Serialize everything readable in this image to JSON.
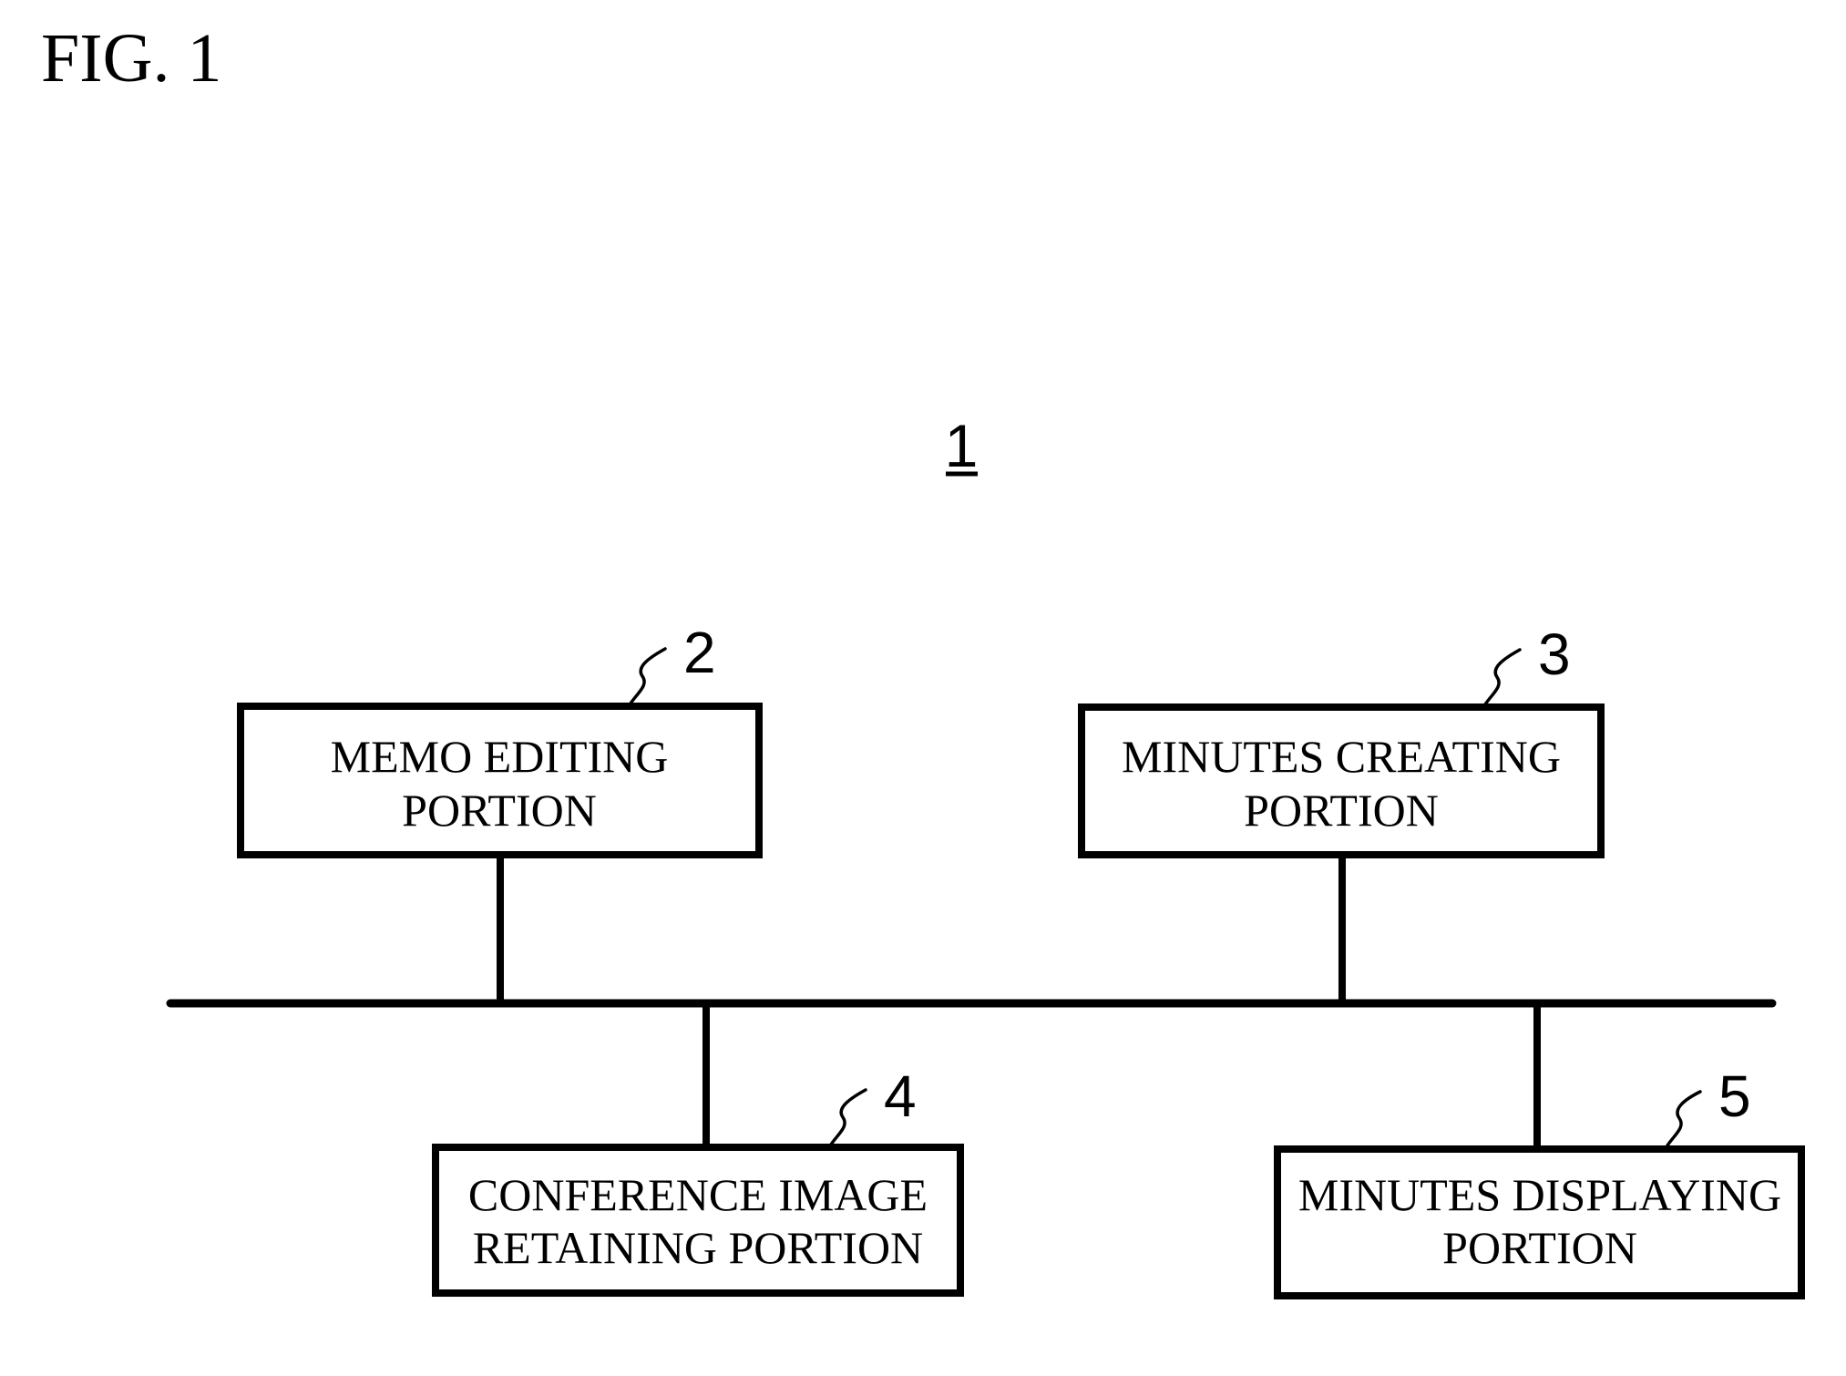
{
  "figure": {
    "title": "FIG. 1",
    "system_ref": "1"
  },
  "components": [
    {
      "ref": "2",
      "lines": [
        "MEMO EDITING",
        "PORTION"
      ]
    },
    {
      "ref": "3",
      "lines": [
        "MINUTES CREATING",
        "PORTION"
      ]
    },
    {
      "ref": "4",
      "lines": [
        "CONFERENCE IMAGE",
        "RETAINING PORTION"
      ]
    },
    {
      "ref": "5",
      "lines": [
        "MINUTES DISPLAYING",
        "PORTION"
      ]
    }
  ],
  "connections": [
    {
      "from": "2",
      "to": "bus"
    },
    {
      "from": "3",
      "to": "bus"
    },
    {
      "from": "bus",
      "to": "4"
    },
    {
      "from": "bus",
      "to": "5"
    }
  ],
  "colors": {
    "ink": "#000000",
    "paper": "#ffffff"
  }
}
